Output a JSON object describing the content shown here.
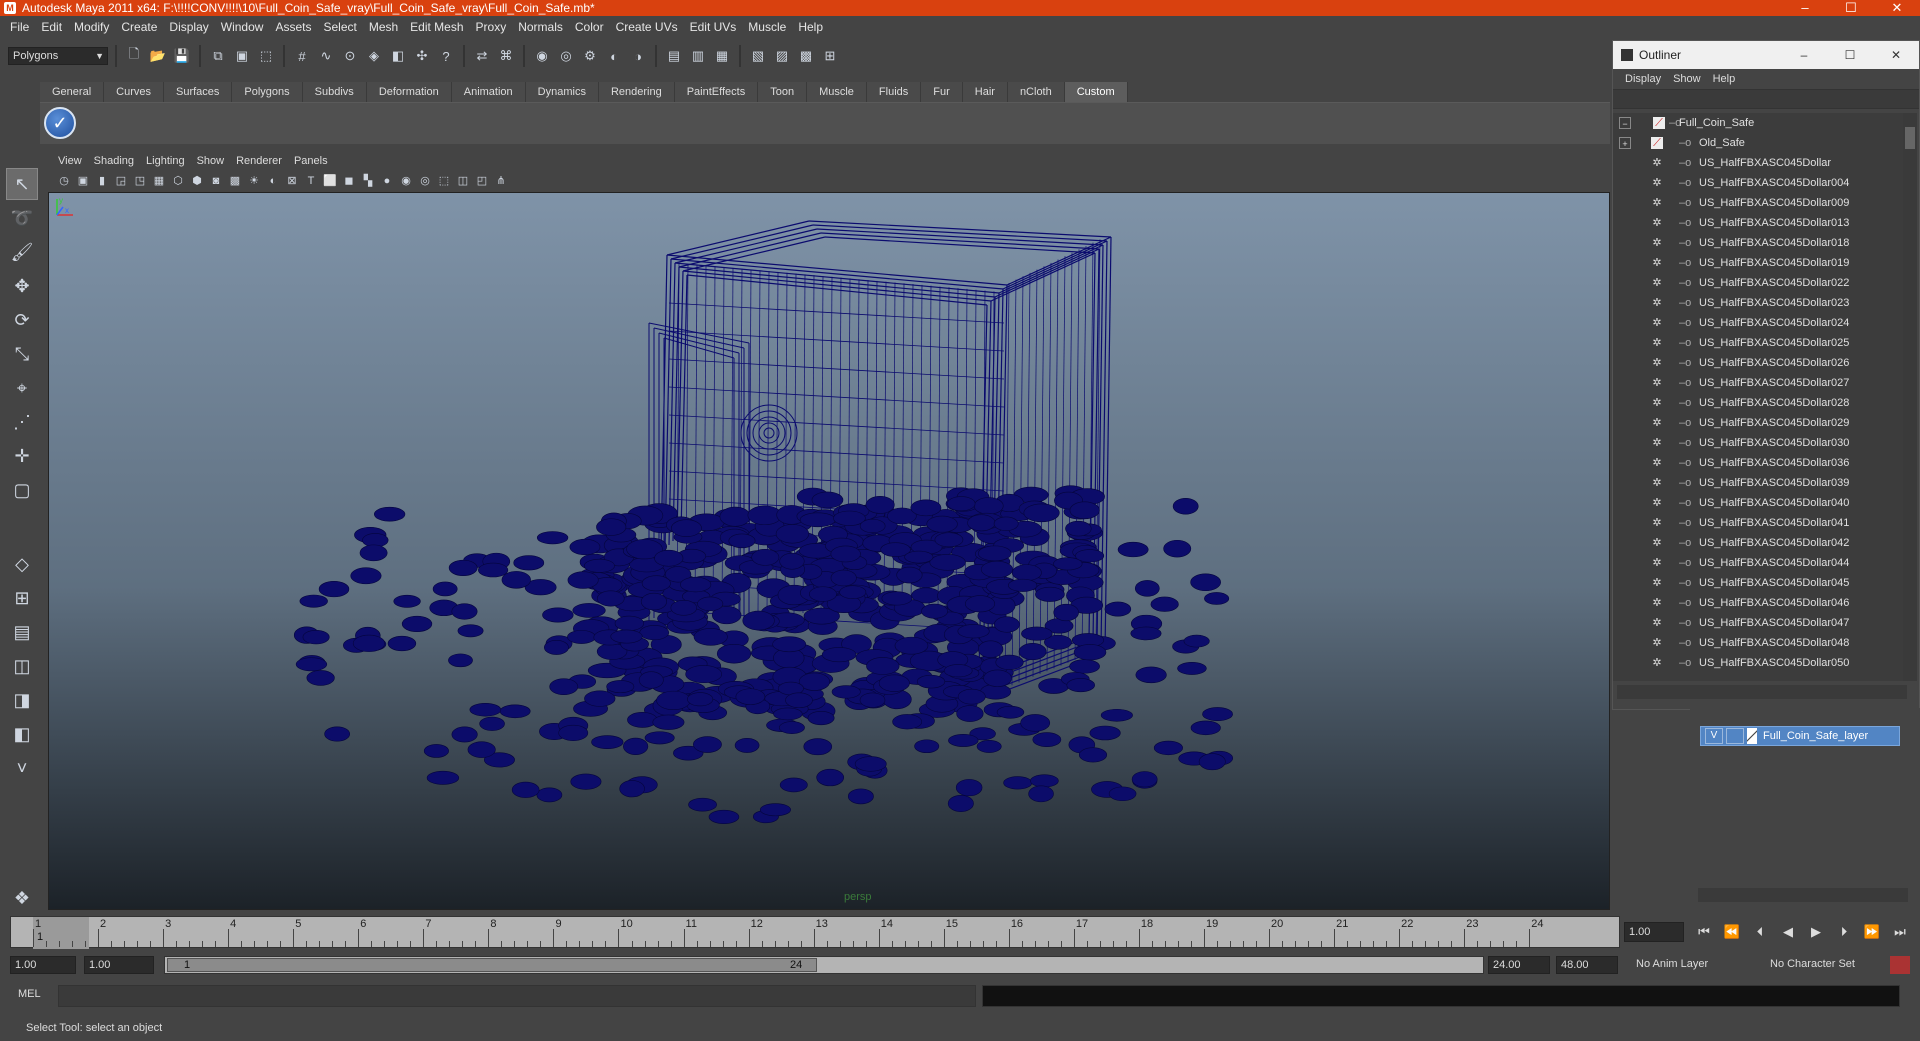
{
  "window": {
    "title": "Autodesk Maya 2011 x64: F:\\!!!!CONV!!!!\\10\\Full_Coin_Safe_vray\\Full_Coin_Safe_vray\\Full_Coin_Safe.mb*",
    "controls": [
      "–",
      "☐",
      "✕"
    ]
  },
  "menubar": [
    "File",
    "Edit",
    "Modify",
    "Create",
    "Display",
    "Window",
    "Assets",
    "Select",
    "Mesh",
    "Edit Mesh",
    "Proxy",
    "Normals",
    "Color",
    "Create UVs",
    "Edit UVs",
    "Muscle",
    "Help"
  ],
  "statusline": {
    "mode": "Polygons"
  },
  "shelf": {
    "tabs": [
      "General",
      "Curves",
      "Surfaces",
      "Polygons",
      "Subdivs",
      "Deformation",
      "Animation",
      "Dynamics",
      "Rendering",
      "PaintEffects",
      "Toon",
      "Muscle",
      "Fluids",
      "Fur",
      "Hair",
      "nCloth",
      "Custom"
    ],
    "active_tab": "Custom"
  },
  "viewport": {
    "menu": [
      "View",
      "Shading",
      "Lighting",
      "Show",
      "Renderer",
      "Panels"
    ],
    "camera_label": "persp",
    "wire_color": "#0b0b6e",
    "coin_color": "#0c0c6a"
  },
  "outliner": {
    "title": "Outliner",
    "menu": [
      "Display",
      "Show",
      "Help"
    ],
    "items": [
      {
        "label": "Full_Coin_Safe",
        "level": 0
      },
      {
        "label": "Old_Safe",
        "level": 1
      },
      {
        "label": "US_HalfFBXASC045Dollar",
        "level": 1
      },
      {
        "label": "US_HalfFBXASC045Dollar004",
        "level": 1
      },
      {
        "label": "US_HalfFBXASC045Dollar009",
        "level": 1
      },
      {
        "label": "US_HalfFBXASC045Dollar013",
        "level": 1
      },
      {
        "label": "US_HalfFBXASC045Dollar018",
        "level": 1
      },
      {
        "label": "US_HalfFBXASC045Dollar019",
        "level": 1
      },
      {
        "label": "US_HalfFBXASC045Dollar022",
        "level": 1
      },
      {
        "label": "US_HalfFBXASC045Dollar023",
        "level": 1
      },
      {
        "label": "US_HalfFBXASC045Dollar024",
        "level": 1
      },
      {
        "label": "US_HalfFBXASC045Dollar025",
        "level": 1
      },
      {
        "label": "US_HalfFBXASC045Dollar026",
        "level": 1
      },
      {
        "label": "US_HalfFBXASC045Dollar027",
        "level": 1
      },
      {
        "label": "US_HalfFBXASC045Dollar028",
        "level": 1
      },
      {
        "label": "US_HalfFBXASC045Dollar029",
        "level": 1
      },
      {
        "label": "US_HalfFBXASC045Dollar030",
        "level": 1
      },
      {
        "label": "US_HalfFBXASC045Dollar036",
        "level": 1
      },
      {
        "label": "US_HalfFBXASC045Dollar039",
        "level": 1
      },
      {
        "label": "US_HalfFBXASC045Dollar040",
        "level": 1
      },
      {
        "label": "US_HalfFBXASC045Dollar041",
        "level": 1
      },
      {
        "label": "US_HalfFBXASC045Dollar042",
        "level": 1
      },
      {
        "label": "US_HalfFBXASC045Dollar044",
        "level": 1
      },
      {
        "label": "US_HalfFBXASC045Dollar045",
        "level": 1
      },
      {
        "label": "US_HalfFBXASC045Dollar046",
        "level": 1
      },
      {
        "label": "US_HalfFBXASC045Dollar047",
        "level": 1
      },
      {
        "label": "US_HalfFBXASC045Dollar048",
        "level": 1
      },
      {
        "label": "US_HalfFBXASC045Dollar050",
        "level": 1
      }
    ]
  },
  "layer_editor": {
    "layer_name": "Full_Coin_Safe_layer",
    "visible": "V",
    "accent": "#5285c4"
  },
  "timeline": {
    "frames": [
      "1",
      "2",
      "3",
      "4",
      "5",
      "6",
      "7",
      "8",
      "9",
      "10",
      "11",
      "12",
      "13",
      "14",
      "15",
      "16",
      "17",
      "18",
      "19",
      "20",
      "21",
      "22",
      "23",
      "24"
    ],
    "current_frame": "1",
    "current_time": "1.00"
  },
  "range": {
    "start_time": "1.00",
    "playback_start": "1.00",
    "range_start_label": "1",
    "range_end_label": "24",
    "playback_end": "24.00",
    "end_time": "48.00",
    "anim_layer": "No Anim Layer",
    "character_set": "No Character Set"
  },
  "command_line": {
    "label": "MEL"
  },
  "help_line": "Select Tool: select an object"
}
